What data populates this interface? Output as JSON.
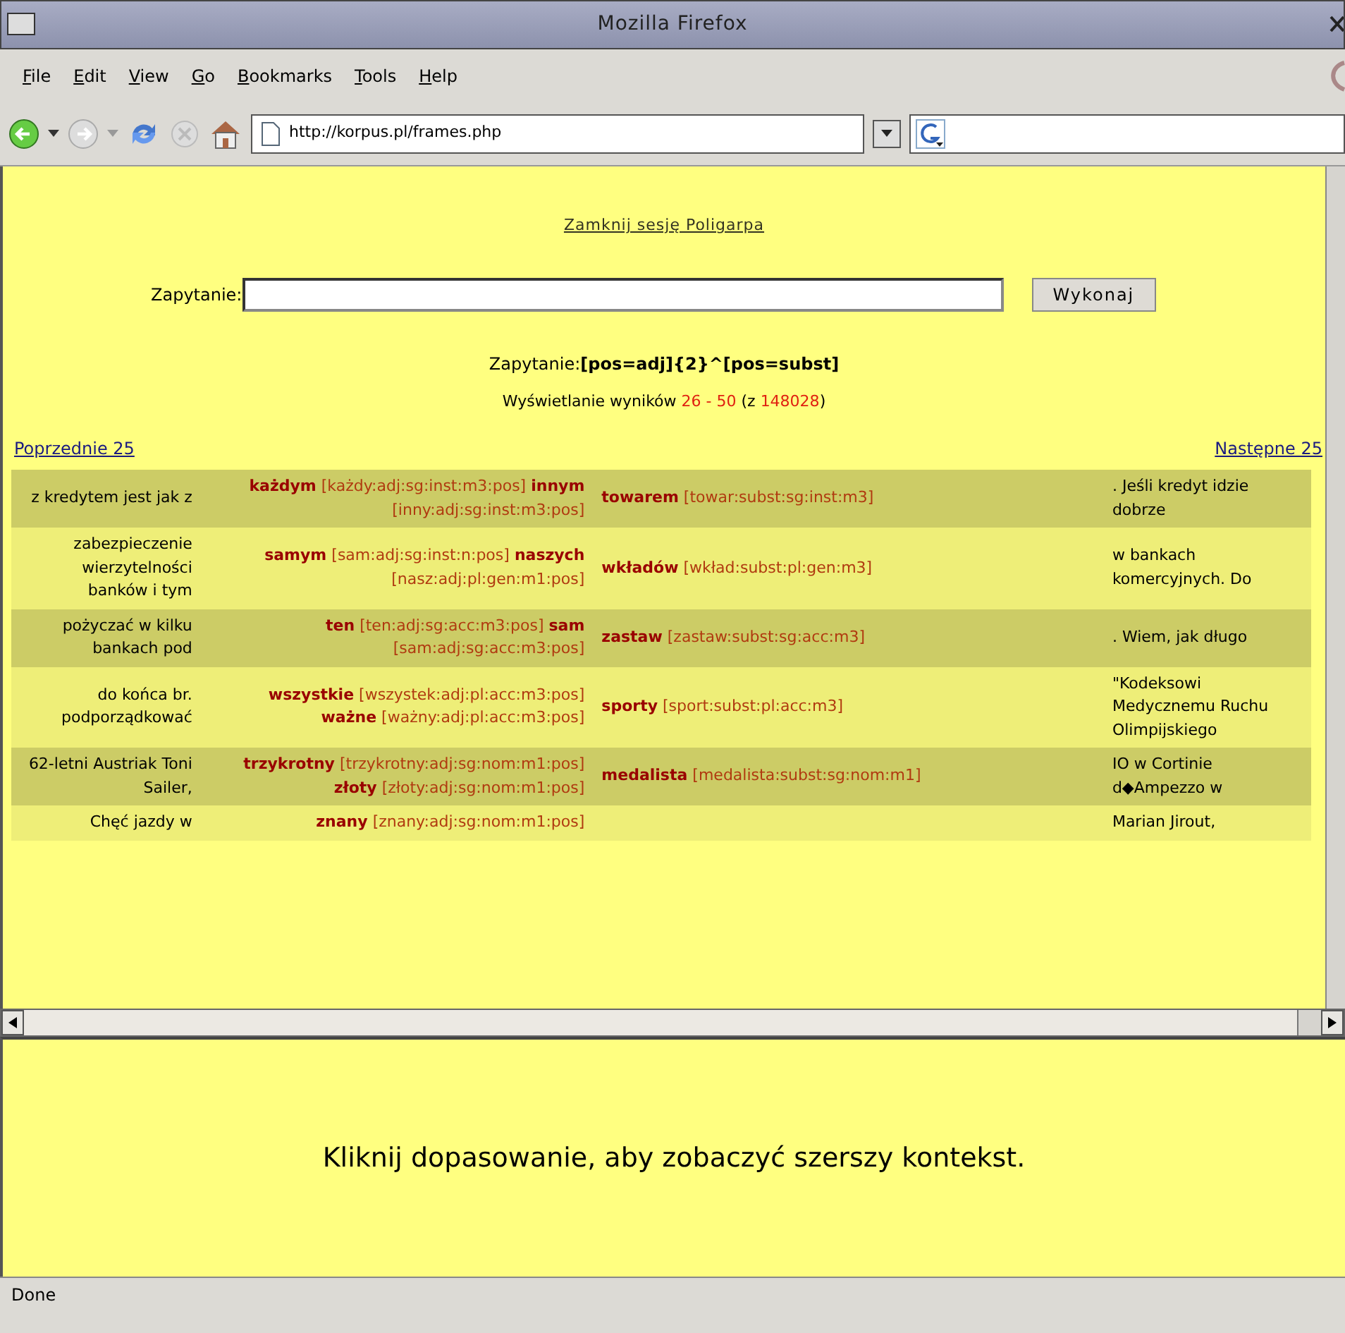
{
  "window": {
    "title": "Mozilla Firefox"
  },
  "menu": [
    {
      "label": "File"
    },
    {
      "label": "Edit"
    },
    {
      "label": "View"
    },
    {
      "label": "Go"
    },
    {
      "label": "Bookmarks"
    },
    {
      "label": "Tools"
    },
    {
      "label": "Help"
    }
  ],
  "toolbar": {
    "url": "http://korpus.pl/frames.php"
  },
  "page": {
    "close_link": "Zamknij sesję Poligarpa",
    "query_label": "Zapytanie:",
    "submit": "Wykonaj",
    "query_display": "Zapytanie:**[pos=adj]{2}^[pos=subst]**",
    "results": [
      {
        "text": "Wyświetlanie wyników ",
        "highlight": false
      },
      {
        "text": "26 - 50",
        "highlight": true
      },
      {
        "text": " (z ",
        "highlight": false
      },
      {
        "text": "148028",
        "highlight": true
      },
      {
        "text": ")",
        "highlight": false
      }
    ],
    "prev": "Poprzednie 25",
    "next": "Następne 25",
    "rows": [
      {
        "left": "z kredytem jest jak z",
        "match": [
          {
            "word": "każdym",
            "tag": "[każdy:adj:sg:inst:m3:pos]"
          },
          {
            "word": "innym",
            "tag": "[inny:adj:sg:inst:m3:pos]"
          }
        ],
        "noun": {
          "word": "towarem",
          "tag": "[towar:subst:sg:inst:m3]"
        },
        "right": ". Jeśli kredyt idzie dobrze"
      },
      {
        "left": "zabezpieczenie wierzytelności banków i tym",
        "match": [
          {
            "word": "samym",
            "tag": "[sam:adj:sg:inst:n:pos]"
          },
          {
            "word": "naszych",
            "tag": "[nasz:adj:pl:gen:m1:pos]"
          }
        ],
        "noun": {
          "word": "wkładów",
          "tag": "[wkład:subst:pl:gen:m3]"
        },
        "right": "w bankach komercyjnych. Do"
      },
      {
        "left": "pożyczać w kilku bankach pod",
        "match": [
          {
            "word": "ten",
            "tag": "[ten:adj:sg:acc:m3:pos]"
          },
          {
            "word": "sam",
            "tag": "[sam:adj:sg:acc:m3:pos]"
          }
        ],
        "noun": {
          "word": "zastaw",
          "tag": "[zastaw:subst:sg:acc:m3]"
        },
        "right": ". Wiem, jak długo"
      },
      {
        "left": "do końca br. podporządkować",
        "match": [
          {
            "word": "wszystkie",
            "tag": "[wszystek:adj:pl:acc:m3:pos]"
          },
          {
            "word": "ważne",
            "tag": "[ważny:adj:pl:acc:m3:pos]"
          }
        ],
        "noun": {
          "word": "sporty",
          "tag": "[sport:subst:pl:acc:m3]"
        },
        "right": "\"Kodeksowi Medycznemu Ruchu Olimpijskiego"
      },
      {
        "left": "62-letni Austriak Toni Sailer,",
        "match": [
          {
            "word": "trzykrotny",
            "tag": "[trzykrotny:adj:sg:nom:m1:pos]"
          },
          {
            "word": "złoty",
            "tag": "[złoty:adj:sg:nom:m1:pos]"
          }
        ],
        "noun": {
          "word": "medalista",
          "tag": "[medalista:subst:sg:nom:m1]"
        },
        "right": "IO w Cortinie d◆Ampezzo w"
      },
      {
        "left": "Chęć jazdy w",
        "match": [
          {
            "word": "znany",
            "tag": "[znany:adj:sg:nom:m1:pos]"
          }
        ],
        "right": "Marian Jirout,"
      }
    ]
  },
  "bottom_frame": {
    "message": "Kliknij dopasowanie, aby zobaczyć szerszy kontekst."
  },
  "status_bar": {
    "text": "Done"
  }
}
